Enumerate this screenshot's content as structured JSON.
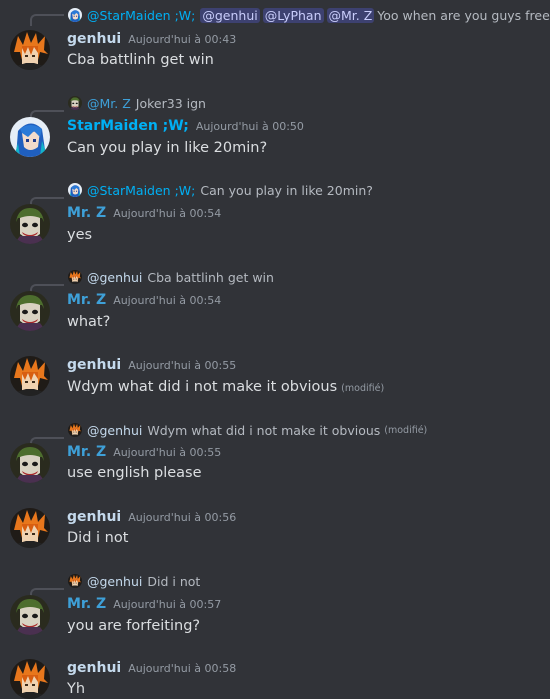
{
  "users": {
    "genhui": {
      "name": "genhui",
      "color": "#c4d9ec",
      "avatar": "flame-hair-avatar"
    },
    "star": {
      "name": "StarMaiden ;W;",
      "color": "#00b0f4",
      "avatar": "blue-anime-avatar"
    },
    "mrz": {
      "name": "Mr. Z",
      "color": "#3ea0d8",
      "avatar": "joker-avatar"
    }
  },
  "m1": {
    "reply_author": "@StarMaiden ;W;",
    "reply_mentions": [
      "@genhui",
      "@LyPhan",
      "@Mr. Z"
    ],
    "reply_text": "Yoo when are you guys free?",
    "author": "genhui",
    "time": "Aujourd'hui à 00:43",
    "text": "Cba battlinh get win"
  },
  "m2": {
    "reply_author": "@Mr. Z",
    "reply_text": "Joker33 ign",
    "author": "StarMaiden ;W;",
    "time": "Aujourd'hui à 00:50",
    "text": "Can you play in like 20min?"
  },
  "m3": {
    "reply_author": "@StarMaiden ;W;",
    "reply_text": "Can you play in like 20min?",
    "author": "Mr. Z",
    "time": "Aujourd'hui à 00:54",
    "text": "yes"
  },
  "m4": {
    "reply_author": "@genhui",
    "reply_text": "Cba battlinh get win",
    "author": "Mr. Z",
    "time": "Aujourd'hui à 00:54",
    "text": "what?"
  },
  "m5": {
    "author": "genhui",
    "time": "Aujourd'hui à 00:55",
    "text": "Wdym what did i not make it obvious",
    "edited": "(modifié)"
  },
  "m6": {
    "reply_author": "@genhui",
    "reply_text": "Wdym what did i not make it obvious",
    "reply_edited": "(modifié)",
    "author": "Mr. Z",
    "time": "Aujourd'hui à 00:55",
    "text": "use english please"
  },
  "m7": {
    "author": "genhui",
    "time": "Aujourd'hui à 00:56",
    "text": "Did i not"
  },
  "m8": {
    "reply_author": "@genhui",
    "reply_text": "Did i not",
    "author": "Mr. Z",
    "time": "Aujourd'hui à 00:57",
    "text": "you are forfeiting?"
  },
  "m9": {
    "author": "genhui",
    "time": "Aujourd'hui à 00:58",
    "text": "Yh"
  }
}
